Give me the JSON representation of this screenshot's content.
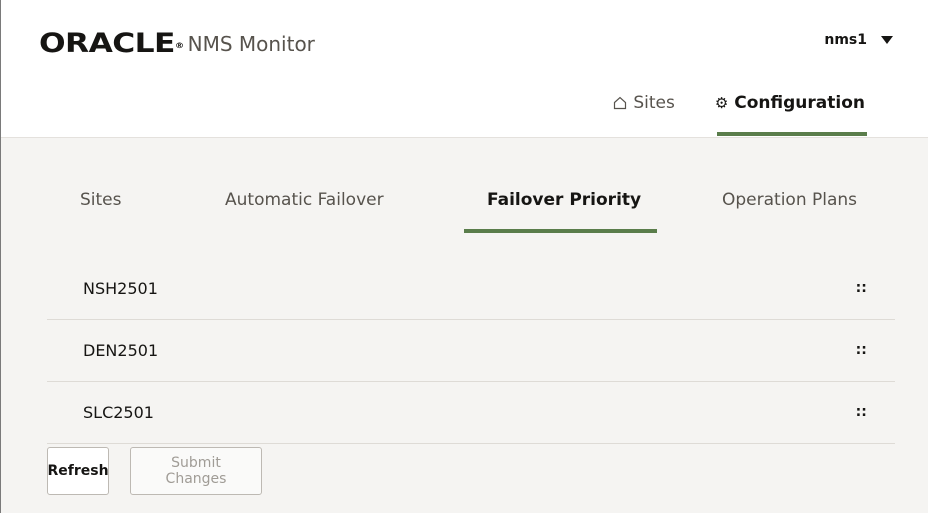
{
  "header": {
    "brand": "ORACLE",
    "registered_mark": "®",
    "app_name": "NMS Monitor",
    "user": "nms1"
  },
  "top_nav": [
    {
      "label": "Sites",
      "icon": "home-icon",
      "active": false
    },
    {
      "label": "Configuration",
      "icon": "gear-icon",
      "active": true
    }
  ],
  "tabs": [
    {
      "label": "Sites",
      "active": false
    },
    {
      "label": "Automatic Failover",
      "active": false
    },
    {
      "label": "Failover Priority",
      "active": true
    },
    {
      "label": "Operation Plans",
      "active": false
    }
  ],
  "priority_list": [
    {
      "label": "NSH2501"
    },
    {
      "label": "DEN2501"
    },
    {
      "label": "SLC2501"
    }
  ],
  "buttons": {
    "refresh": "Refresh",
    "submit": "Submit Changes",
    "submit_disabled": true
  },
  "colors": {
    "accent": "#5a7d4b",
    "content_bg": "#f5f4f2",
    "text": "#161513"
  },
  "drag_handle_glyph": "∷"
}
